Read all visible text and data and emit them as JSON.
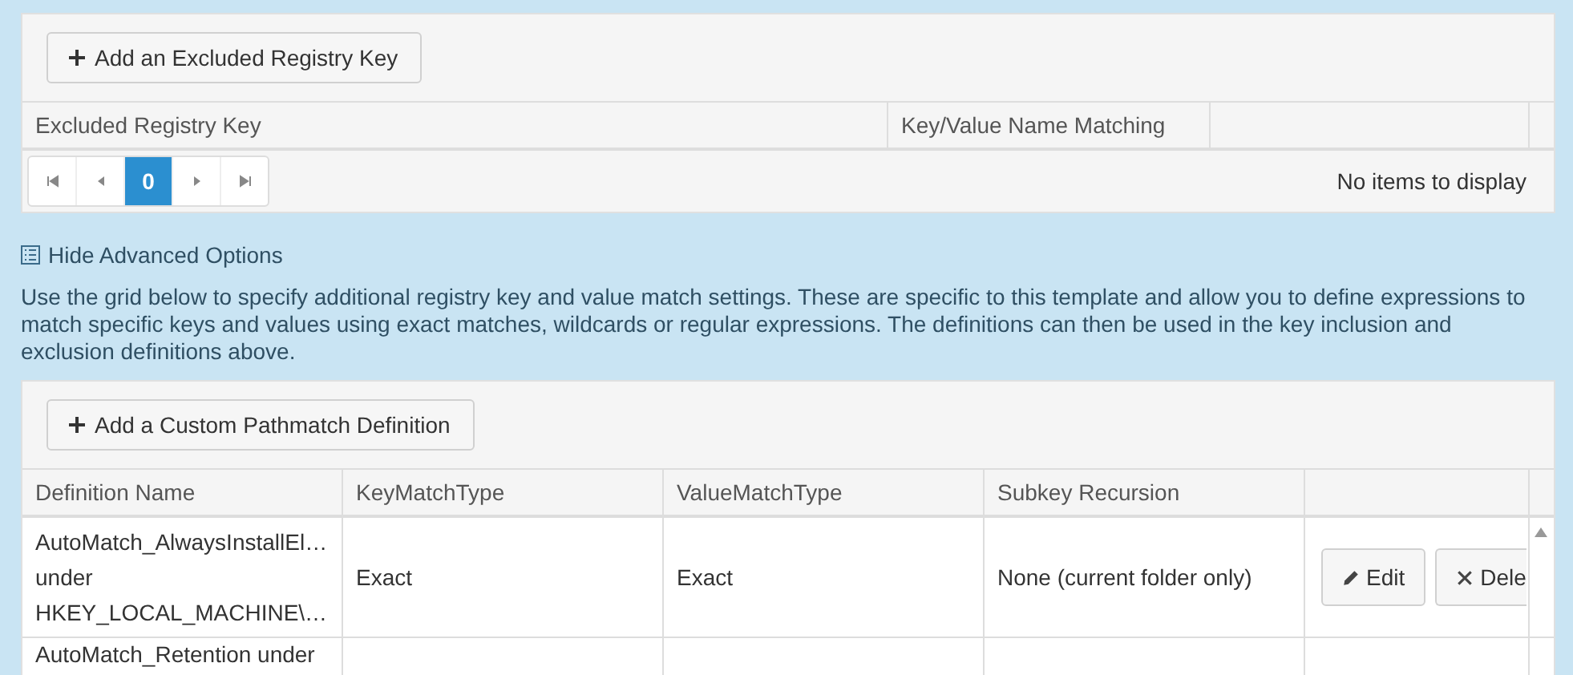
{
  "excluded_keys": {
    "add_button": "Add an Excluded Registry Key",
    "columns": [
      "Excluded Registry Key",
      "Key/Value Name Matching"
    ],
    "pager": {
      "pages": [
        {
          "label": "0",
          "selected": true
        }
      ],
      "status": "No items to display"
    }
  },
  "advanced_toggle": "Hide Advanced Options",
  "description": "Use the grid below to specify additional registry key and value match settings. These are specific to this template and allow you to define expressions to match specific keys and values using exact matches, wildcards or regular expressions. The definitions can then be used in the key inclusion and exclusion definitions above.",
  "pathmatch": {
    "add_button": "Add a Custom Pathmatch Definition",
    "columns": [
      "Definition Name",
      "KeyMatchType",
      "ValueMatchType",
      "Subkey Recursion"
    ],
    "rows": [
      {
        "name": [
          "AutoMatch_AlwaysInstallEl…",
          "under",
          "HKEY_LOCAL_MACHINE\\…"
        ],
        "key_match": "Exact",
        "value_match": "Exact",
        "recursion": "None (current folder only)",
        "edit": "Edit",
        "delete": "Dele"
      },
      {
        "name": [
          "AutoMatch_Retention under"
        ]
      }
    ]
  }
}
